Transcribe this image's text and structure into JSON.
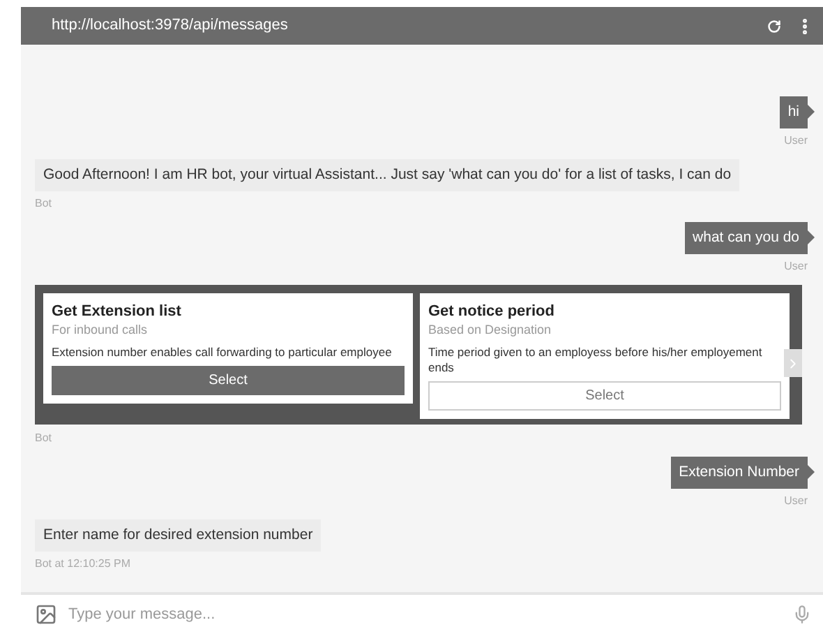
{
  "header": {
    "url": "http://localhost:3978/api/messages"
  },
  "messages": [
    {
      "kind": "user",
      "text": "hi",
      "meta": "User"
    },
    {
      "kind": "bot",
      "text": "Good Afternoon! I am HR bot, your virtual Assistant... Just say 'what can you do' for a list of tasks, I can do",
      "meta": "Bot"
    },
    {
      "kind": "user",
      "text": "what can you do",
      "meta": "User"
    },
    {
      "kind": "carousel",
      "meta": "Bot",
      "cards": [
        {
          "title": "Get Extension list",
          "subtitle": "For inbound calls",
          "text": "Extension number enables call forwarding to particular employee",
          "button": "Select",
          "selected": true
        },
        {
          "title": "Get notice period",
          "subtitle": "Based on Designation",
          "text": "Time period given to an employess before his/her employement ends",
          "button": "Select",
          "selected": false
        }
      ]
    },
    {
      "kind": "user",
      "text": "Extension Number",
      "meta": "User"
    },
    {
      "kind": "bot",
      "text": "Enter name for desired extension number",
      "meta": "Bot at 12:10:25 PM"
    }
  ],
  "input": {
    "placeholder": "Type your message..."
  }
}
